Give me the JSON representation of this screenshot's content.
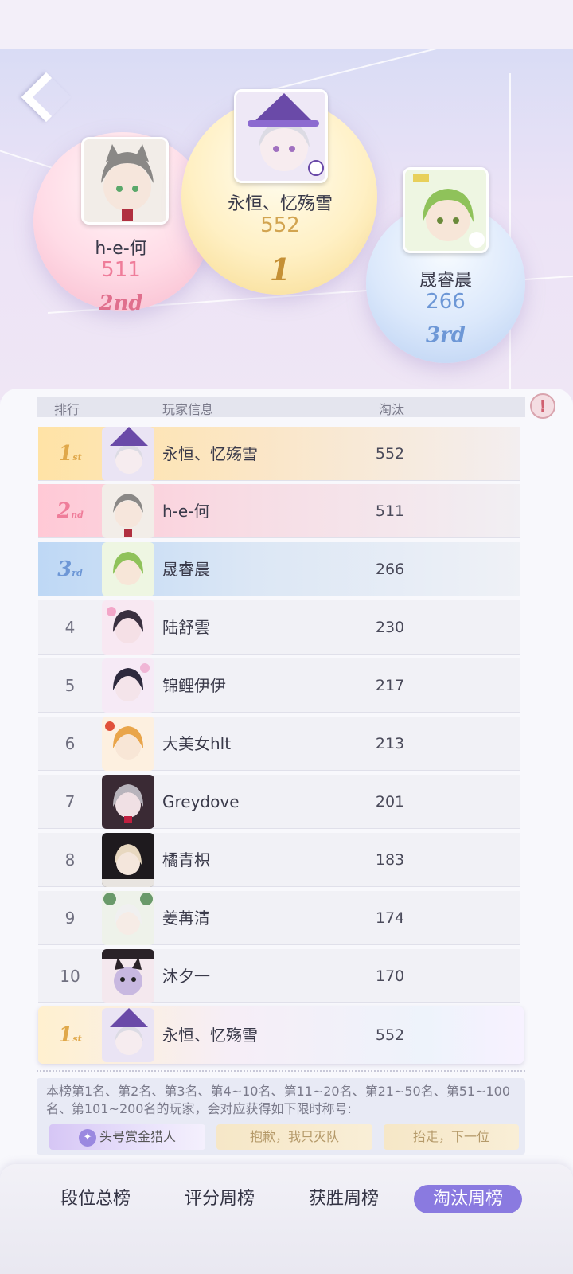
{
  "podium": [
    {
      "place": "second",
      "name": "h-e-何",
      "score": "511",
      "rank_mark": "2nd"
    },
    {
      "place": "first",
      "name": "永恒、忆殇雪",
      "score": "552",
      "rank_mark": "1"
    },
    {
      "place": "third",
      "name": "晟睿晨",
      "score": "266",
      "rank_mark": "3rd"
    }
  ],
  "table": {
    "col_rank": "排行",
    "col_player": "玩家信息",
    "col_score": "淘汰",
    "rows": [
      {
        "rank": "1",
        "suffix": "st",
        "name": "永恒、忆殇雪",
        "score": "552"
      },
      {
        "rank": "2",
        "suffix": "nd",
        "name": "h-e-何",
        "score": "511"
      },
      {
        "rank": "3",
        "suffix": "rd",
        "name": "晟睿晨",
        "score": "266"
      },
      {
        "rank": "4",
        "name": "陆舒雲",
        "score": "230"
      },
      {
        "rank": "5",
        "name": "锦鲤伊伊",
        "score": "217"
      },
      {
        "rank": "6",
        "name": "大美女hlt",
        "score": "213"
      },
      {
        "rank": "7",
        "name": "Greydove",
        "score": "201"
      },
      {
        "rank": "8",
        "name": "橘青枳",
        "score": "183"
      },
      {
        "rank": "9",
        "name": "姜苒清",
        "score": "174"
      },
      {
        "rank": "10",
        "name": "沐夕一",
        "score": "170"
      }
    ]
  },
  "my_rank": {
    "rank": "1",
    "suffix": "st",
    "name": "永恒、忆殇雪",
    "score": "552"
  },
  "notice": {
    "text": "本榜第1名、第2名、第3名、第4~10名、第11~20名、第21~50名、第51~100名、第101~200名的玩家，会对应获得如下限时称号:",
    "titles": [
      "头号赏金猎人",
      "抱歉，我只灭队",
      "抬走，下一位"
    ]
  },
  "nav": {
    "tabs": [
      "段位总榜",
      "评分周榜",
      "获胜周榜",
      "淘汰周榜"
    ],
    "active": "淘汰周榜"
  },
  "colors": {
    "accent": "#8a7ae0",
    "gold": "#e0a84a",
    "pink": "#ef7d9a",
    "blue": "#6d97d6"
  }
}
